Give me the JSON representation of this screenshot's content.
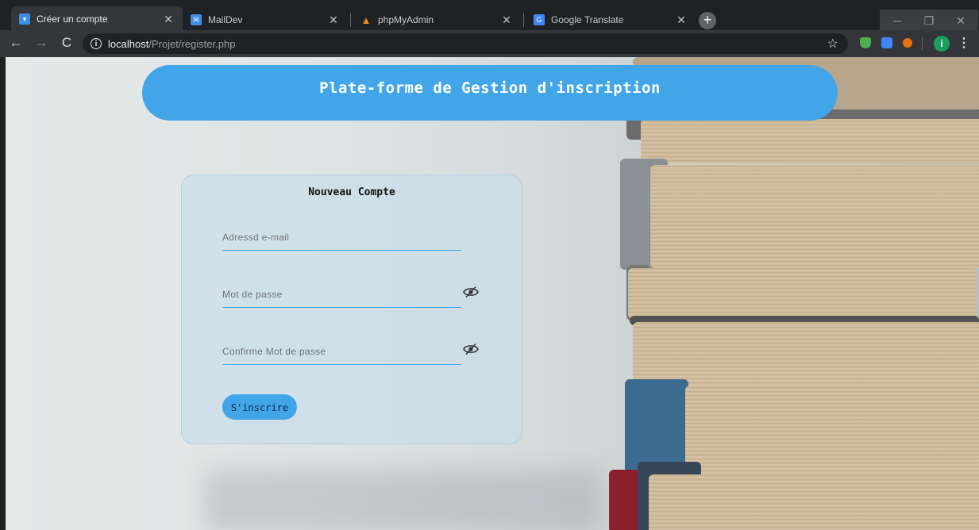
{
  "browser": {
    "tabs": [
      {
        "label": "Créer un compte",
        "active": true,
        "icon": "page-icon",
        "color": "#3c8ee6"
      },
      {
        "label": "MailDev",
        "active": false,
        "icon": "mail-icon",
        "color": "#3c8ee6"
      },
      {
        "label": "phpMyAdmin",
        "active": false,
        "icon": "phpmyadmin-icon",
        "color": "#f29111"
      },
      {
        "label": "Google Translate",
        "active": false,
        "icon": "translate-icon",
        "color": "#4285f4"
      }
    ],
    "address": {
      "host": "localhost",
      "path": "/Projet/register.php"
    }
  },
  "page": {
    "banner_title": "Plate-forme de Gestion d'inscription",
    "form": {
      "title": "Nouveau Compte",
      "email_placeholder": "Adressd e-mail",
      "password_placeholder": "Mot de passe",
      "confirm_placeholder": "Confirme Mot de passe",
      "submit_label": "S'inscrire"
    }
  },
  "colors": {
    "accent": "#42a5e8"
  }
}
